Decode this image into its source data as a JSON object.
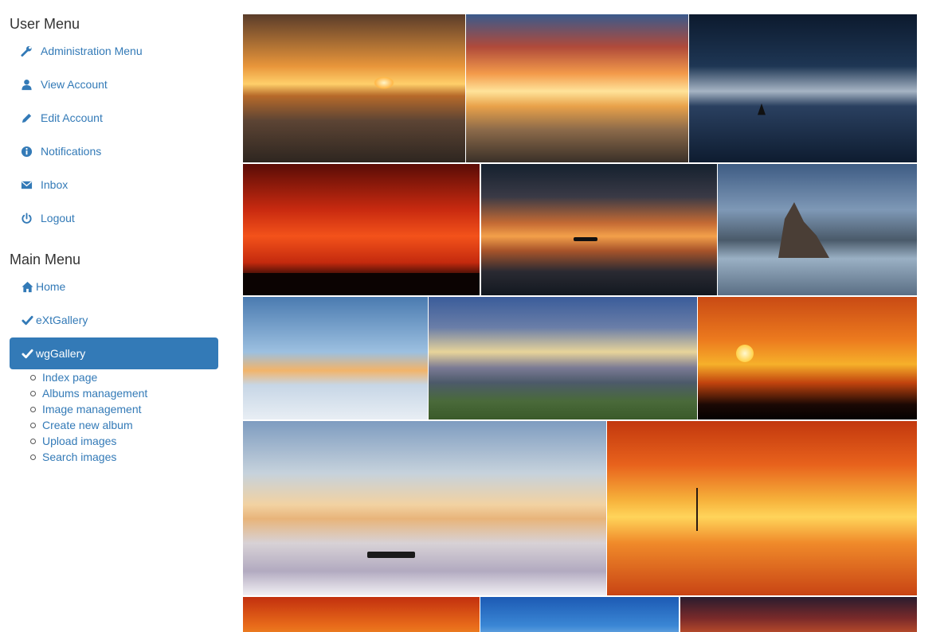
{
  "user_menu": {
    "title": "User Menu",
    "items": [
      {
        "label": "Administration Menu",
        "icon": "wrench-icon"
      },
      {
        "label": "View Account",
        "icon": "user-icon"
      },
      {
        "label": "Edit Account",
        "icon": "pencil-icon"
      },
      {
        "label": "Notifications",
        "icon": "info-icon"
      },
      {
        "label": "Inbox",
        "icon": "envelope-icon"
      },
      {
        "label": "Logout",
        "icon": "power-icon"
      }
    ]
  },
  "main_menu": {
    "title": "Main Menu",
    "items": [
      {
        "label": "Home",
        "icon": "home-icon"
      },
      {
        "label": "eXtGallery",
        "icon": "check-icon"
      },
      {
        "label": "wgGallery",
        "icon": "check-icon",
        "active": true
      }
    ],
    "submenu": [
      {
        "label": "Index page"
      },
      {
        "label": "Albums management"
      },
      {
        "label": "Image management"
      },
      {
        "label": "Create new album"
      },
      {
        "label": "Upload images"
      },
      {
        "label": "Search images"
      }
    ]
  },
  "colors": {
    "link": "#337ab7",
    "active_bg": "#337ab7",
    "active_text": "#ffffff",
    "heading": "#333333"
  }
}
